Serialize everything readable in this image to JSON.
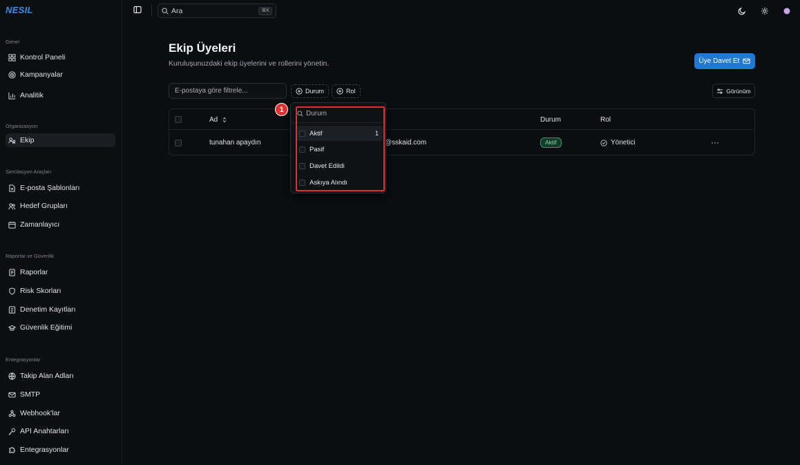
{
  "app": {
    "logo": "NESIL"
  },
  "topbar": {
    "search_label": "Ara",
    "search_shortcut": "⌘K"
  },
  "sidebar": {
    "sections": [
      {
        "title": "Genel",
        "items": [
          {
            "label": "Kontrol Paneli",
            "icon": "grid-icon"
          },
          {
            "label": "Kampanyalar",
            "icon": "target-icon"
          },
          {
            "label": "Analitik",
            "icon": "chart-icon"
          }
        ]
      },
      {
        "title": "Organizasyon",
        "items": [
          {
            "label": "Ekip",
            "icon": "users-icon",
            "active": true
          }
        ]
      },
      {
        "title": "Simülasyon Araçları",
        "items": [
          {
            "label": "E-posta Şablonları",
            "icon": "file-icon"
          },
          {
            "label": "Hedef Grupları",
            "icon": "group-icon"
          },
          {
            "label": "Zamanlayıcı",
            "icon": "calendar-icon"
          }
        ]
      },
      {
        "title": "Raporlar ve Güvenlik",
        "items": [
          {
            "label": "Raporlar",
            "icon": "report-icon"
          },
          {
            "label": "Risk Skorları",
            "icon": "shield-icon"
          },
          {
            "label": "Denetim Kayıtları",
            "icon": "audit-icon"
          },
          {
            "label": "Güvenlik Eğitimi",
            "icon": "graduation-icon"
          }
        ]
      },
      {
        "title": "Entegrasyonlar",
        "items": [
          {
            "label": "Takip Alan Adları",
            "icon": "globe-icon"
          },
          {
            "label": "SMTP",
            "icon": "mail-icon"
          },
          {
            "label": "Webhook'lar",
            "icon": "webhook-icon"
          },
          {
            "label": "API Anahtarları",
            "icon": "key-icon"
          },
          {
            "label": "Entegrasyonlar",
            "icon": "puzzle-icon"
          }
        ]
      }
    ]
  },
  "main": {
    "title": "Ekip Üyeleri",
    "subtitle": "Kuruluşunuzdaki ekip üyelerini ve rollerini yönetin.",
    "invite_button": "Üye Davet Et",
    "filter_placeholder": "E-postaya göre filtrele...",
    "chip_status": "Durum",
    "chip_role": "Rol",
    "view_button": "Görünüm"
  },
  "table": {
    "columns": [
      "Ad",
      "Durum",
      "Rol"
    ],
    "rows": [
      {
        "name": "tunahan apaydın",
        "email_suffix": "@sskaid.com",
        "status": "Aktif",
        "role": "Yönetici",
        "actions": "···"
      }
    ]
  },
  "status_dropdown": {
    "search_placeholder": "Durum",
    "options": [
      {
        "label": "Aktif",
        "count": "1"
      },
      {
        "label": "Pasif",
        "count": ""
      },
      {
        "label": "Davet Edildi",
        "count": ""
      },
      {
        "label": "Askıya Alındı",
        "count": ""
      }
    ]
  },
  "annotation": {
    "number": "1",
    "color": "#e0302f"
  },
  "colors": {
    "accent": "#1f78d1",
    "logo": "#3b8ee8",
    "success": "#2f9e6b",
    "background": "#0b0d10"
  }
}
